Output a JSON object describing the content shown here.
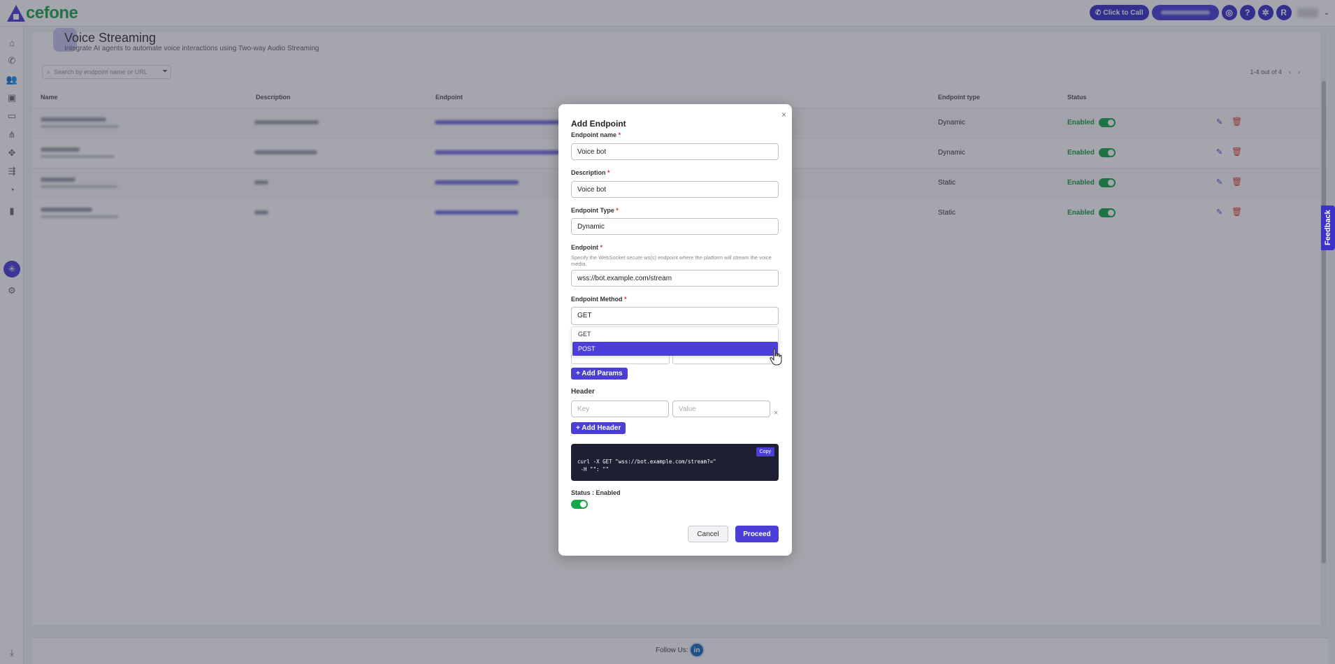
{
  "topbar": {
    "logo_text": "cefone",
    "click_to_call": "Click to Call",
    "user_initial": "R",
    "help_label": "?"
  },
  "sidebar": {
    "items": [
      "home-icon",
      "phone-icon",
      "users-icon",
      "wallet-icon",
      "monitor-icon",
      "network-icon",
      "integration-icon",
      "call-flow-icon",
      "analytics-icon",
      "bar-chart-icon",
      "ai-agent-icon",
      "settings-icon",
      "download-icon"
    ],
    "active": "ai-agent-icon"
  },
  "page": {
    "title": "Voice Streaming",
    "subtitle": "Integrate AI agents to automate voice interactions using Two-way Audio Streaming",
    "search_placeholder": "Search by endpoint name or URL",
    "pagination": "1-4 out of 4"
  },
  "table": {
    "columns": [
      "Name",
      "Description",
      "Endpoint",
      "Endpoint type",
      "Status"
    ],
    "rows": [
      {
        "type": "Dynamic",
        "status": "Enabled"
      },
      {
        "type": "Dynamic",
        "status": "Enabled"
      },
      {
        "type": "Static",
        "status": "Enabled"
      },
      {
        "type": "Static",
        "status": "Enabled"
      }
    ]
  },
  "modal": {
    "title": "Add Endpoint",
    "endpoint_name_label": "Endpoint name",
    "endpoint_name_value": "Voice bot",
    "description_label": "Description",
    "description_value": "Voice bot",
    "endpoint_type_label": "Endpoint Type",
    "endpoint_type_value": "Dynamic",
    "endpoint_label": "Endpoint",
    "endpoint_hint": "Specify the WebSocket secure ws(s) endpoint where the platform will stream the voice media.",
    "endpoint_value": "wss://bot.example.com/stream",
    "method_label": "Endpoint Method",
    "method_value": "GET",
    "method_options": [
      "GET",
      "POST"
    ],
    "method_highlighted": "POST",
    "add_params": "+ Add Params",
    "header_label": "Header",
    "header_key_placeholder": "Key",
    "header_value_placeholder": "Value",
    "add_header": "+ Add Header",
    "copy_label": "Copy",
    "code_line_1": "curl -X GET \"wss://bot.example.com/stream?=\"",
    "code_line_2": " -H \"\": \"\"",
    "status_label": "Status : Enabled",
    "status_enabled": true,
    "cancel": "Cancel",
    "proceed": "Proceed"
  },
  "footer": {
    "follow_us": "Follow Us:",
    "linkedin": "in"
  },
  "feedback_tab": "Feedback",
  "colors": {
    "brand": "#4b3fd8",
    "logo_green": "#1aa84a",
    "enabled": "#18a84a",
    "delete": "#e03b3b"
  }
}
